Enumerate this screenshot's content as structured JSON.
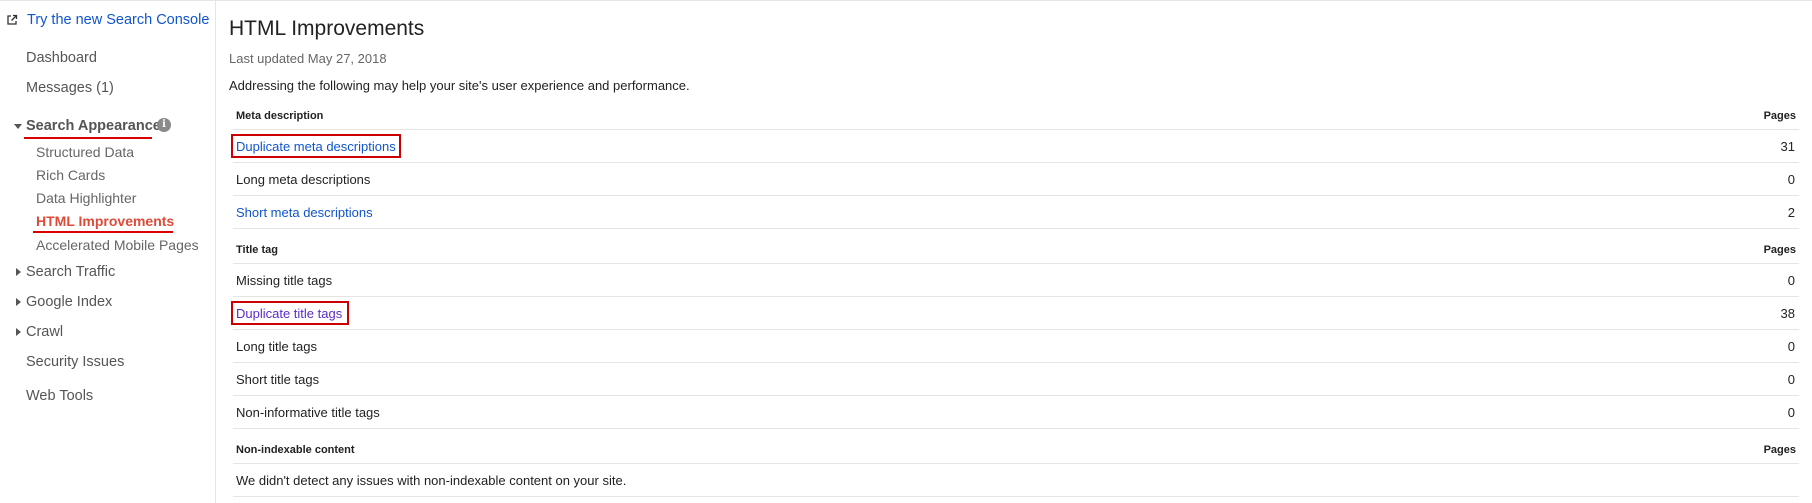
{
  "sidebar": {
    "new_console": "Try the new Search Console",
    "dashboard": "Dashboard",
    "messages": "Messages (1)",
    "search_appearance": "Search Appearance",
    "sub": [
      "Structured Data",
      "Rich Cards",
      "Data Highlighter",
      "HTML Improvements",
      "Accelerated Mobile Pages"
    ],
    "search_traffic": "Search Traffic",
    "google_index": "Google Index",
    "crawl": "Crawl",
    "security_issues": "Security Issues",
    "web_tools": "Web Tools",
    "info_glyph": "i"
  },
  "main": {
    "title": "HTML Improvements",
    "last_updated": "Last updated May 27, 2018",
    "intro": "Addressing the following may help your site's user experience and performance."
  },
  "sections": {
    "meta": {
      "header": "Meta description",
      "pages_label": "Pages",
      "rows": [
        {
          "label": "Duplicate meta descriptions",
          "value": "31"
        },
        {
          "label": "Long meta descriptions",
          "value": "0"
        },
        {
          "label": "Short meta descriptions",
          "value": "2"
        }
      ]
    },
    "title": {
      "header": "Title tag",
      "pages_label": "Pages",
      "rows": [
        {
          "label": "Missing title tags",
          "value": "0"
        },
        {
          "label": "Duplicate title tags",
          "value": "38"
        },
        {
          "label": "Long title tags",
          "value": "0"
        },
        {
          "label": "Short title tags",
          "value": "0"
        },
        {
          "label": "Non-informative title tags",
          "value": "0"
        }
      ]
    },
    "nonindex": {
      "header": "Non-indexable content",
      "pages_label": "Pages",
      "message": "We didn't detect any issues with non-indexable content on your site."
    }
  },
  "colors": {
    "link": "#1155cc",
    "visited_link": "#5b2bc8",
    "active_nav": "#dd4b39",
    "highlight_box": "#cc0000"
  },
  "icons": [
    "external-link-icon",
    "expand-down-icon",
    "expand-right-icon",
    "info-icon"
  ]
}
